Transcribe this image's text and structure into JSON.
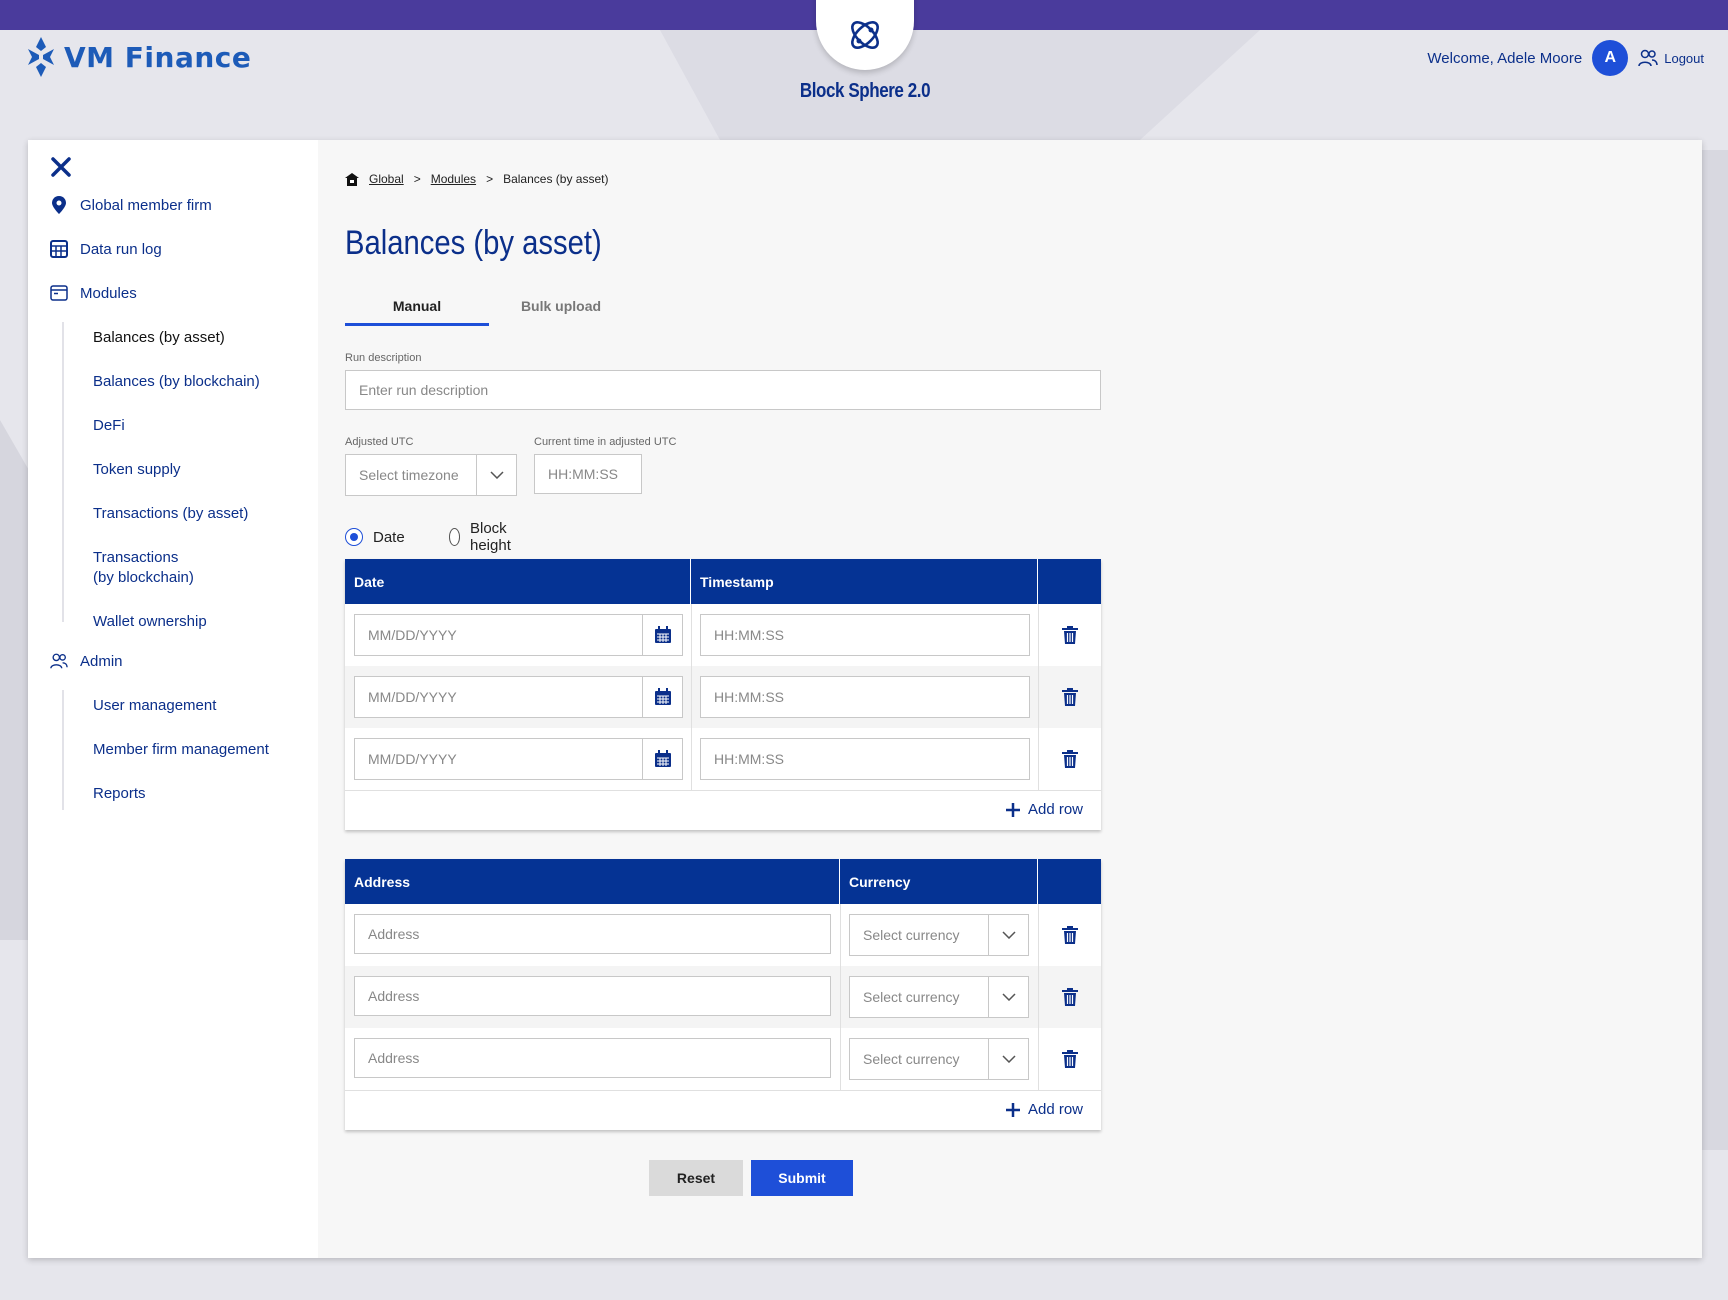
{
  "brand": {
    "name": "VM Finance",
    "product": "Block Sphere 2.0"
  },
  "user": {
    "welcome": "Welcome, Adele Moore",
    "initial": "A",
    "logout": "Logout"
  },
  "sidebar": {
    "items": [
      {
        "label": "Global member firm"
      },
      {
        "label": "Data run log"
      },
      {
        "label": "Modules"
      },
      {
        "label": "Admin"
      }
    ],
    "modules": [
      "Balances (by asset)",
      "Balances (by blockchain)",
      "DeFi",
      "Token supply",
      "Transactions (by asset)",
      "Transactions\n(by blockchain)",
      "Wallet ownership"
    ],
    "admin": [
      "User management",
      "Member firm management",
      "Reports"
    ]
  },
  "breadcrumb": {
    "global": "Global",
    "modules": "Modules",
    "current": "Balances (by asset)",
    "sep": ">"
  },
  "page_title": "Balances (by asset)",
  "tabs": {
    "manual": "Manual",
    "bulk": "Bulk upload"
  },
  "form": {
    "run_description_label": "Run description",
    "run_description_placeholder": "Enter run description",
    "adjusted_utc_label": "Adjusted UTC",
    "timezone_placeholder": "Select timezone",
    "current_time_label": "Current time in adjusted UTC",
    "current_time_placeholder": "HH:MM:SS",
    "radio_date": "Date",
    "radio_block_height": "Block height",
    "radio_selected": "Date"
  },
  "date_table": {
    "headers": {
      "date": "Date",
      "timestamp": "Timestamp"
    },
    "rows": [
      {
        "date": "MM/DD/YYYY",
        "timestamp": "HH:MM:SS"
      },
      {
        "date": "MM/DD/YYYY",
        "timestamp": "HH:MM:SS"
      },
      {
        "date": "MM/DD/YYYY",
        "timestamp": "HH:MM:SS"
      }
    ],
    "add_row": "Add row"
  },
  "address_table": {
    "headers": {
      "address": "Address",
      "currency": "Currency"
    },
    "rows": [
      {
        "address": "Address",
        "currency": "Select currency"
      },
      {
        "address": "Address",
        "currency": "Select currency"
      },
      {
        "address": "Address",
        "currency": "Select currency"
      }
    ],
    "add_row": "Add row"
  },
  "actions": {
    "reset": "Reset",
    "submit": "Submit"
  },
  "icons": {
    "brand_mark": "vm-logo-icon",
    "product_mark": "blocksphere-logo-icon",
    "close": "close-icon",
    "location": "location-pin-icon",
    "table": "table-grid-icon",
    "modules": "window-icon",
    "admin": "users-icon",
    "home": "home-icon",
    "calendar": "calendar-icon",
    "trash": "trash-icon",
    "chevron": "chevron-down-icon",
    "plus": "plus-icon"
  },
  "colors": {
    "accent": "#1e4fd8",
    "navy": "#053394",
    "brand_text": "#1d5bb8",
    "topbar": "#4a3b9c"
  }
}
